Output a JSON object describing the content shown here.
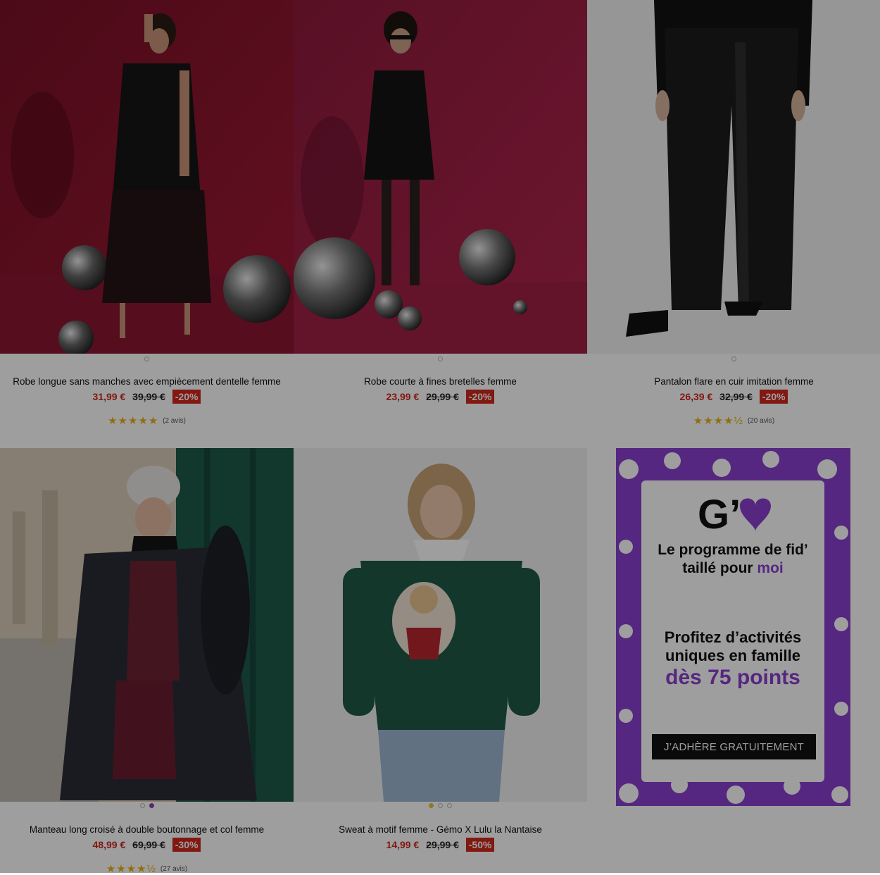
{
  "products": [
    {
      "title": "Robe longue sans manches avec empiècement dentelle femme",
      "price": "31,99 €",
      "old_price": "39,99 €",
      "discount": "-20%",
      "stars": "★★★★★",
      "reviews": "(2 avis)"
    },
    {
      "title": "Robe courte à fines bretelles femme",
      "price": "23,99 €",
      "old_price": "29,99 €",
      "discount": "-20%"
    },
    {
      "title": "Pantalon flare en cuir imitation femme",
      "price": "26,39 €",
      "old_price": "32,99 €",
      "discount": "-20%",
      "stars": "★★★★½",
      "reviews": "(20 avis)"
    },
    {
      "title": "Manteau long croisé à double boutonnage et col femme",
      "price": "48,99 €",
      "old_price": "69,99 €",
      "discount": "-30%",
      "stars": "★★★★½",
      "reviews": "(27 avis)"
    },
    {
      "title": "Sweat à motif femme - Gémo X Lulu la Nantaise",
      "price": "14,99 €",
      "old_price": "29,99 €",
      "discount": "-50%"
    }
  ],
  "promo": {
    "logo": "G’",
    "line1a": "Le programme de fid’",
    "line1b": "taillé pour",
    "line1c": "moi",
    "line2a": "Profitez d’activités",
    "line2b": "uniques en famille",
    "line2c": "dès 75 points",
    "button": "J’ADHÈRE GRATUITEMENT"
  },
  "colors": {
    "accent_purple": "#8a3fcf",
    "price_red": "#d0271d",
    "star_gold": "#e8b219"
  }
}
